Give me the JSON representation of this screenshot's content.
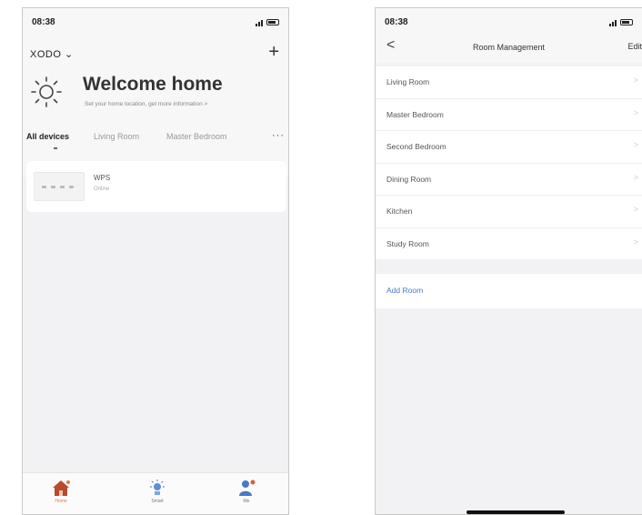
{
  "left": {
    "status": {
      "time": "08:38"
    },
    "header": {
      "home_name": "XODO ⌄",
      "add_label": "+"
    },
    "welcome": {
      "title": "Welcome home",
      "subtitle": "Set your home location, get more information  >"
    },
    "tabs": [
      {
        "label": "All devices"
      },
      {
        "label": "Living Room"
      },
      {
        "label": "Master Bedroom"
      }
    ],
    "tab_more": "···",
    "device": {
      "name": "WPS",
      "status": "Online"
    },
    "tabbar": [
      {
        "label": "Home",
        "icon": "house-icon"
      },
      {
        "label": "Smart",
        "icon": "smart-icon"
      },
      {
        "label": "Me",
        "icon": "person-icon"
      }
    ],
    "colors": {
      "accent": "#e67a3c"
    }
  },
  "right": {
    "status": {
      "time": "08:38"
    },
    "nav": {
      "back": "<",
      "title": "Room Management",
      "edit": "Edit"
    },
    "rooms": [
      {
        "label": "Living Room"
      },
      {
        "label": "Master Bedroom"
      },
      {
        "label": "Second Bedroom"
      },
      {
        "label": "Dining Room"
      },
      {
        "label": "Kitchen"
      },
      {
        "label": "Study Room"
      }
    ],
    "chevron": ">",
    "add_room": "Add Room",
    "colors": {
      "link": "#4a78c4"
    }
  }
}
